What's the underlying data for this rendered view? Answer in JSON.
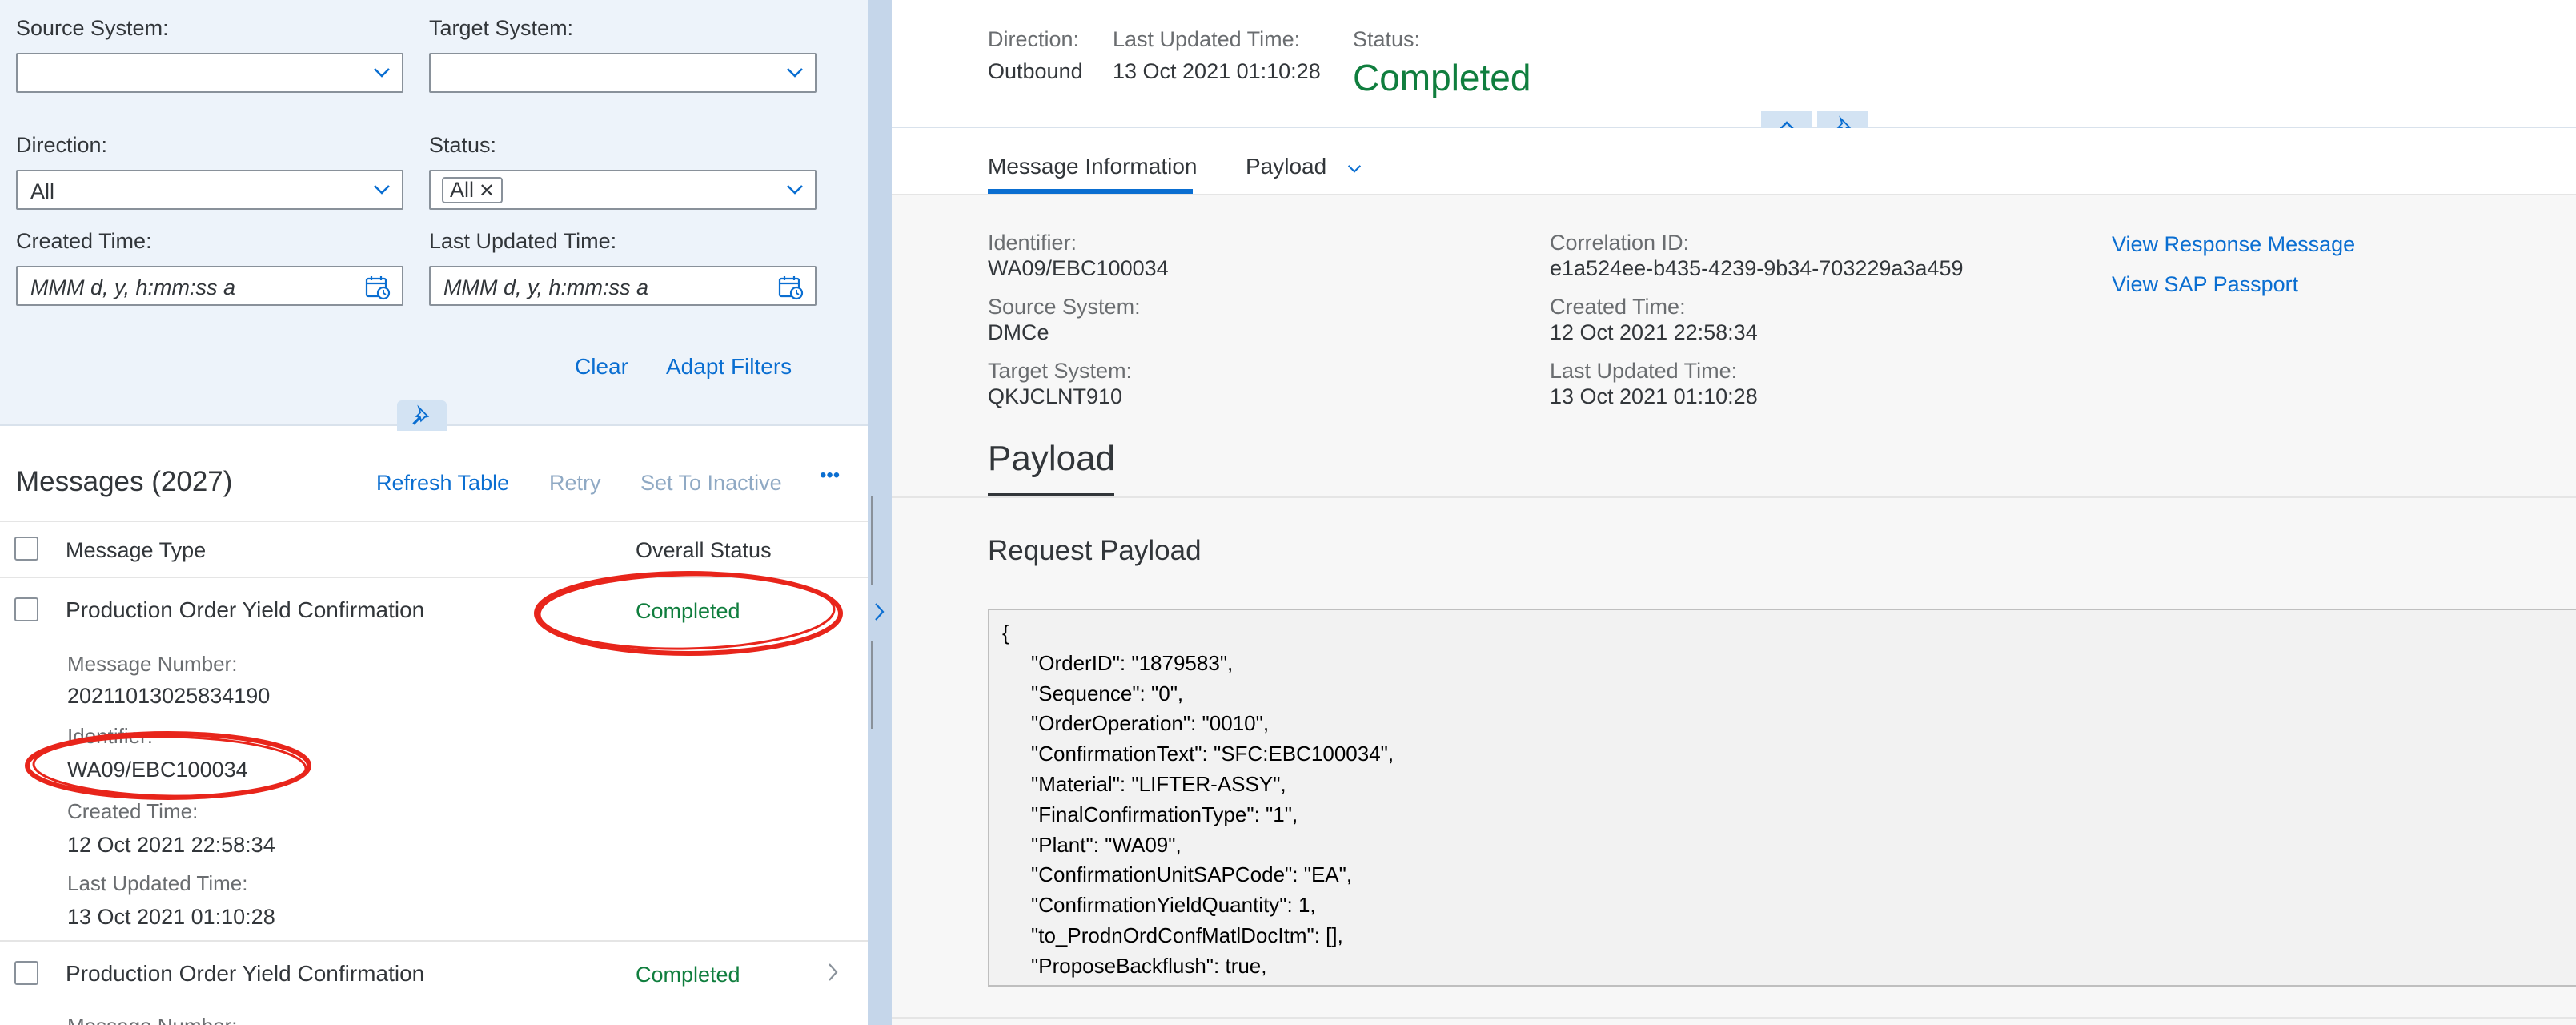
{
  "filters": {
    "source_system_label": "Source System:",
    "target_system_label": "Target System:",
    "direction_label": "Direction:",
    "direction_value": "All",
    "status_label": "Status:",
    "status_token": "All",
    "created_time_label": "Created Time:",
    "created_time_placeholder": "MMM d, y, h:mm:ss a",
    "last_updated_label": "Last Updated Time:",
    "last_updated_placeholder": "MMM d, y, h:mm:ss a",
    "clear_label": "Clear",
    "adapt_label": "Adapt Filters"
  },
  "table": {
    "title": "Messages (2027)",
    "refresh_label": "Refresh Table",
    "retry_label": "Retry",
    "set_inactive_label": "Set To Inactive",
    "more_label": "•••",
    "col_message_type": "Message Type",
    "col_overall_status": "Overall Status",
    "rows": [
      {
        "type": "Production Order Yield Confirmation",
        "status": "Completed",
        "message_number_label": "Message Number:",
        "message_number": "20211013025834190",
        "identifier_label": "Identifier:",
        "identifier": "WA09/EBC100034",
        "created_label": "Created Time:",
        "created": "12 Oct 2021 22:58:34",
        "updated_label": "Last Updated Time:",
        "updated": "13 Oct 2021 01:10:28"
      },
      {
        "type": "Production Order Yield Confirmation",
        "status": "Completed",
        "message_number_label": "Message Number:"
      }
    ]
  },
  "header": {
    "direction_label": "Direction:",
    "direction_value": "Outbound",
    "last_updated_label": "Last Updated Time:",
    "last_updated_value": "13 Oct 2021 01:10:28",
    "status_label": "Status:",
    "status_value": "Completed"
  },
  "tabs": [
    {
      "label": "Message Information"
    },
    {
      "label": "Payload"
    }
  ],
  "details": {
    "identifier_label": "Identifier:",
    "identifier": "WA09/EBC100034",
    "source_label": "Source System:",
    "source": "DMCe",
    "target_label": "Target System:",
    "target": "QKJCLNT910",
    "correlation_label": "Correlation ID:",
    "correlation": "e1a524ee-b435-4239-9b34-703229a3a459",
    "created_label": "Created Time:",
    "created": "12 Oct 2021 22:58:34",
    "updated_label": "Last Updated Time:",
    "updated": "13 Oct 2021 01:10:28",
    "view_response_label": "View Response Message",
    "view_passport_label": "View SAP Passport"
  },
  "payload": {
    "section_title": "Payload",
    "request_title": "Request Payload",
    "lines": [
      "{",
      "\"OrderID\": \"1879583\",",
      "\"Sequence\": \"0\",",
      "\"OrderOperation\": \"0010\",",
      "\"ConfirmationText\": \"SFC:EBC100034\",",
      "\"Material\": \"LIFTER-ASSY\",",
      "\"FinalConfirmationType\": \"1\",",
      "\"Plant\": \"WA09\",",
      "\"ConfirmationUnitSAPCode\": \"EA\",",
      "\"ConfirmationYieldQuantity\": 1,",
      "\"to_ProdnOrdConfMatlDocItm\": [],",
      "\"ProposeBackflush\": true,"
    ]
  },
  "colors": {
    "accent": "#0a6ed1",
    "success": "#107e3e",
    "annotation": "#e8251b"
  }
}
